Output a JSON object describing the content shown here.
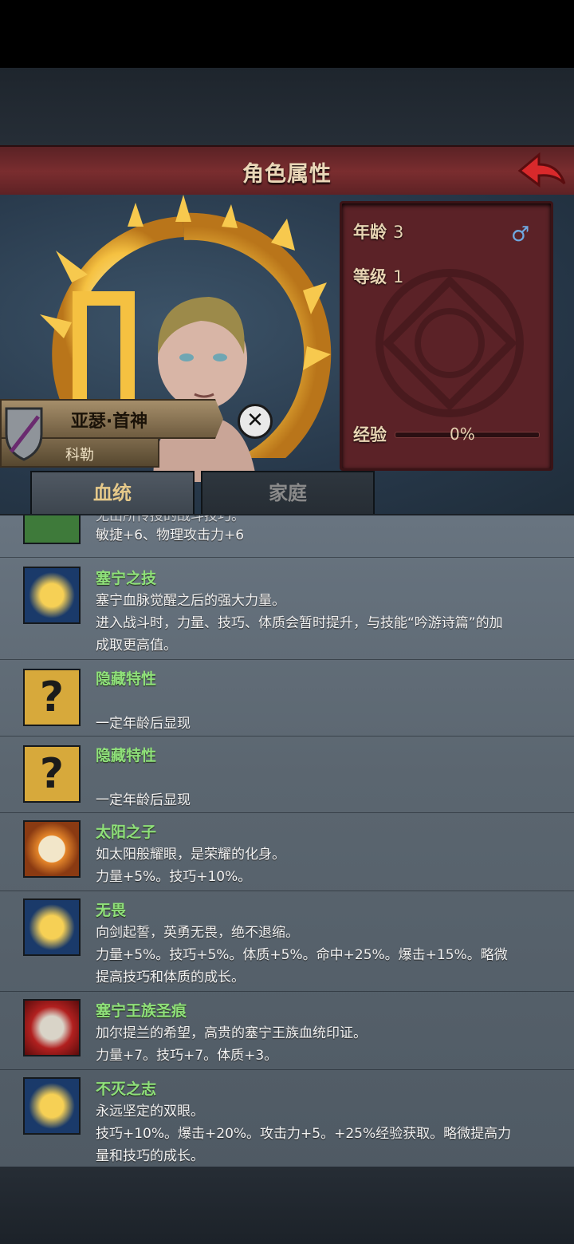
{
  "header": {
    "title": "角色属性"
  },
  "character": {
    "name": "亚瑟·首神",
    "family": "科勒",
    "age_label": "年龄",
    "age": "3",
    "level_label": "等级",
    "level": "1",
    "exp_label": "经验",
    "exp": "0%",
    "gender": "♂"
  },
  "tabs": [
    {
      "label": "血统"
    },
    {
      "label": "家庭"
    }
  ],
  "traits": [
    {
      "title": "",
      "lines": [
        "无出所传授的战斗技巧。",
        "敏捷+6、物理攻击力+6"
      ]
    },
    {
      "title": "塞宁之技",
      "lines": [
        "塞宁血脉觉醒之后的强大力量。",
        "进入战斗时，力量、技巧、体质会暂时提升，与技能“吟游诗篇”的加",
        "成取更高值。"
      ]
    },
    {
      "title": "隐藏特性",
      "lines": [
        "一定年龄后显现"
      ]
    },
    {
      "title": "隐藏特性",
      "lines": [
        "一定年龄后显现"
      ]
    },
    {
      "title": "太阳之子",
      "lines": [
        "如太阳般耀眼，是荣耀的化身。",
        "力量+5%。技巧+10%。"
      ]
    },
    {
      "title": "无畏",
      "lines": [
        "向剑起誓，英勇无畏，绝不退缩。",
        "力量+5%。技巧+5%。体质+5%。命中+25%。爆击+15%。略微",
        "提高技巧和体质的成长。"
      ]
    },
    {
      "title": "塞宁王族圣痕",
      "lines": [
        "加尔提兰的希望，高贵的塞宁王族血统印证。",
        "力量+7。技巧+7。体质+3。"
      ]
    },
    {
      "title": "不灭之志",
      "lines": [
        "永远坚定的双眼。",
        "技巧+10%。爆击+20%。攻击力+5。+25%经验获取。略微提高力",
        "量和技巧的成长。"
      ]
    }
  ]
}
